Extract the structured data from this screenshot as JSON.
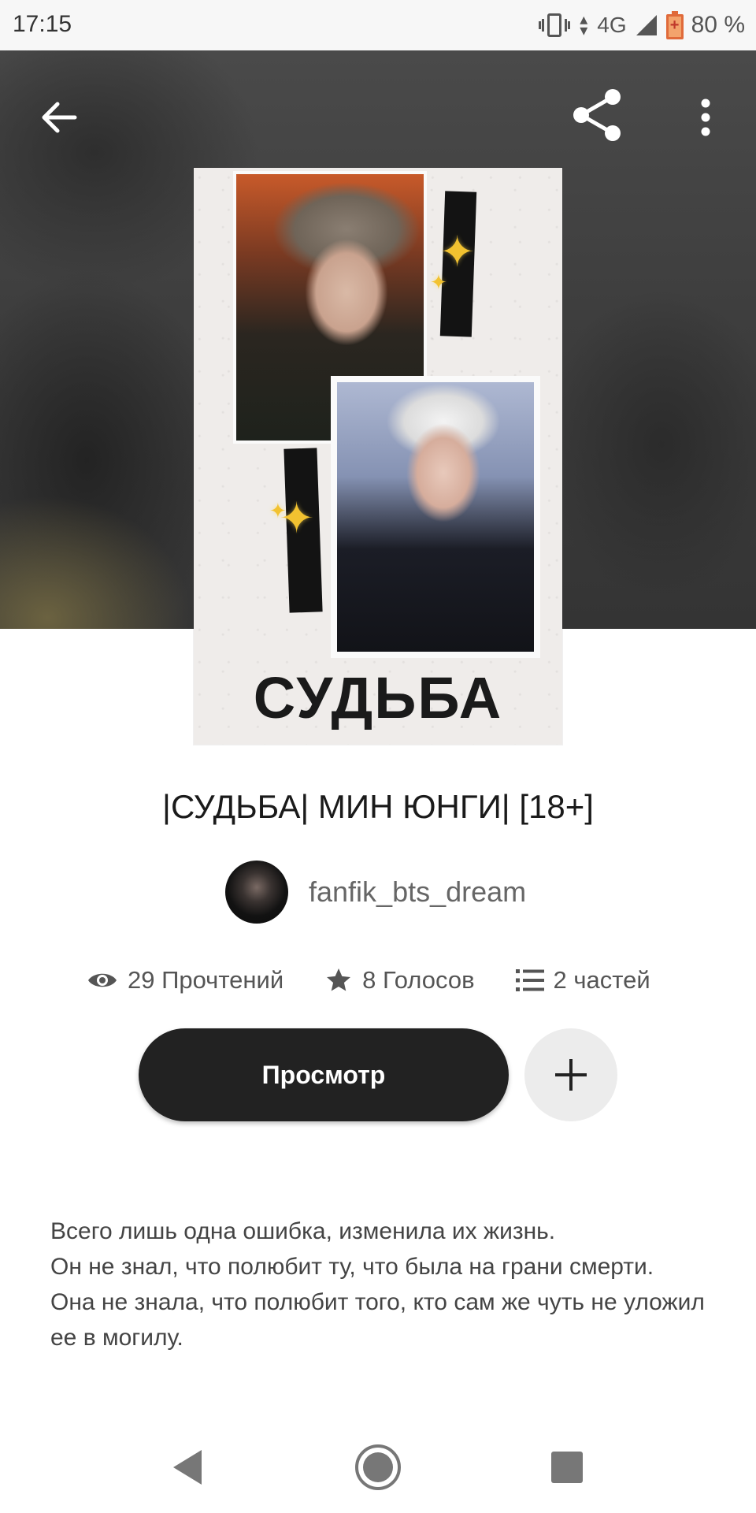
{
  "status_bar": {
    "time": "17:15",
    "network": "4G",
    "battery": "80 %"
  },
  "toolbar": {
    "back_icon": "arrow-left-icon",
    "share_icon": "share-icon",
    "more_icon": "more-vert-icon"
  },
  "cover": {
    "title_text": "СУДЬБА"
  },
  "story": {
    "title": "|СУДЬБА| МИН ЮНГИ| [18+]",
    "author": "fanfik_bts_dream",
    "stats": {
      "reads": "29 Прочтений",
      "votes": "8 Голосов",
      "parts": "2 частей"
    },
    "read_button": "Просмотр",
    "add_button_icon": "plus-icon",
    "description": [
      "Всего лишь одна ошибка, изменила их жизнь.",
      "Он не знал, что полюбит ту, что была на грани смерти.",
      "Она не знала, что полюбит того, кто сам же чуть не уложил ее в могилу."
    ]
  },
  "colors": {
    "button_dark": "#222222",
    "add_button_bg": "#ececec",
    "sparkle": "#f2c230",
    "battery": "#e06a3a"
  },
  "nav_bar": {
    "back_icon": "nav-back-icon",
    "home_icon": "nav-home-icon",
    "recents_icon": "nav-recents-icon"
  }
}
